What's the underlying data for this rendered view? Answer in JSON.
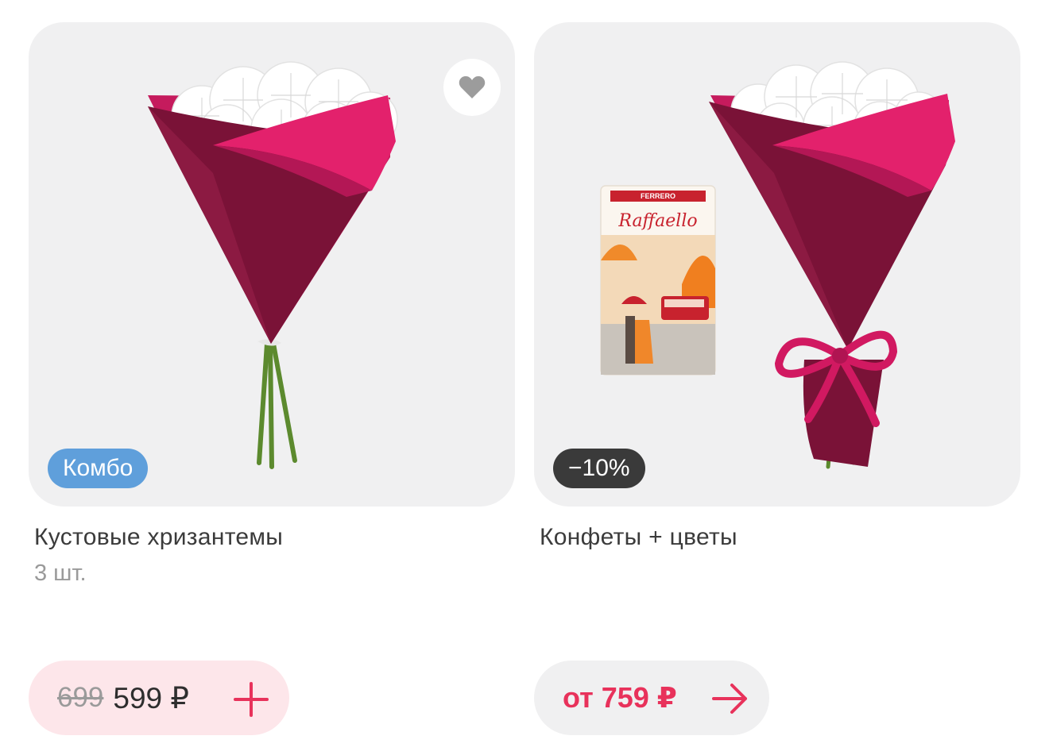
{
  "products": [
    {
      "badge": "Комбо",
      "title": "Кустовые хризантемы",
      "subtitle": "3 шт.",
      "old_price": "699",
      "price": "599 ₽",
      "action_icon": "plus-icon",
      "favorite_icon": "heart-icon"
    },
    {
      "badge": "−10%",
      "title": "Конфеты + цветы",
      "price": "от 759 ₽",
      "action_icon": "arrow-right-icon",
      "candy_box": {
        "maker": "FERRERO",
        "brand": "Raffaello"
      }
    }
  ],
  "colors": {
    "accent": "#e8325b",
    "combo_badge": "#5f9fdb",
    "discount_badge": "#3a3a3a",
    "card_bg": "#f0f0f1",
    "wrap_dark": "#7a1237",
    "wrap_light": "#e3216c"
  }
}
